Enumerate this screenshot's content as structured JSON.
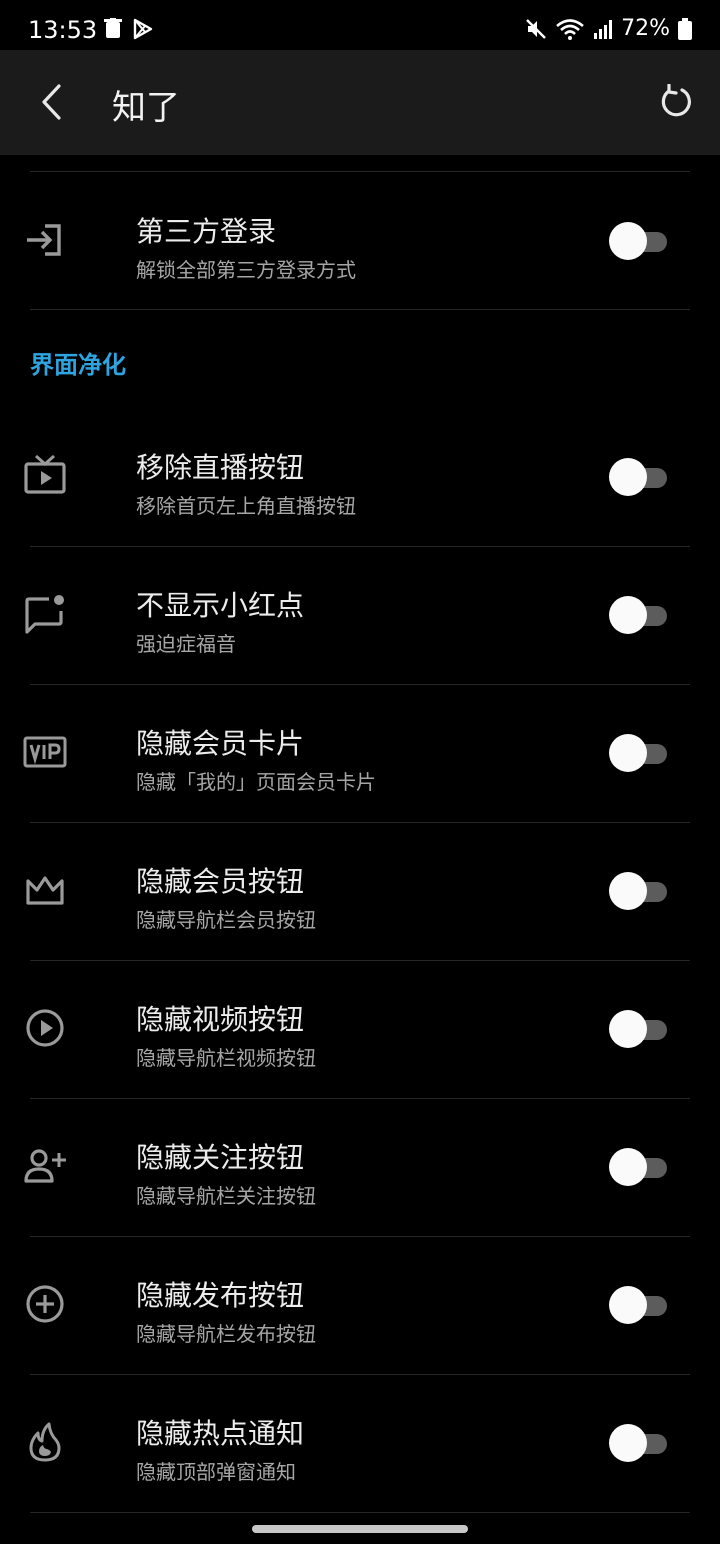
{
  "status_bar": {
    "time": "13:53",
    "battery_text": "72%",
    "icons": [
      "trash-icon",
      "play-store-icon",
      "mute-icon",
      "wifi-icon",
      "signal-icon",
      "battery-icon"
    ]
  },
  "app_bar": {
    "title": "知了",
    "back_icon": "chevron-left-icon",
    "reset_icon": "refresh-icon"
  },
  "colors": {
    "accent": "#2ea4e0",
    "background": "#000000",
    "appbar": "#1b1b1b",
    "toggle_track_off": "#5c5c5c"
  },
  "top_item": {
    "title": "第三方登录",
    "subtitle": "解锁全部第三方登录方式",
    "icon": "login-icon",
    "enabled": false
  },
  "section": {
    "title": "界面净化",
    "items": [
      {
        "title": "移除直播按钮",
        "subtitle": "移除首页左上角直播按钮",
        "icon": "tv-icon",
        "enabled": false
      },
      {
        "title": "不显示小红点",
        "subtitle": "强迫症福音",
        "icon": "chat-badge-icon",
        "enabled": false
      },
      {
        "title": "隐藏会员卡片",
        "subtitle": "隐藏「我的」页面会员卡片",
        "icon": "vip-icon",
        "enabled": false
      },
      {
        "title": "隐藏会员按钮",
        "subtitle": "隐藏导航栏会员按钮",
        "icon": "crown-icon",
        "enabled": false
      },
      {
        "title": "隐藏视频按钮",
        "subtitle": "隐藏导航栏视频按钮",
        "icon": "play-circle-icon",
        "enabled": false
      },
      {
        "title": "隐藏关注按钮",
        "subtitle": "隐藏导航栏关注按钮",
        "icon": "person-add-icon",
        "enabled": false
      },
      {
        "title": "隐藏发布按钮",
        "subtitle": "隐藏导航栏发布按钮",
        "icon": "plus-circle-icon",
        "enabled": false
      },
      {
        "title": "隐藏热点通知",
        "subtitle": "隐藏顶部弹窗通知",
        "icon": "flame-icon",
        "enabled": false
      }
    ]
  }
}
